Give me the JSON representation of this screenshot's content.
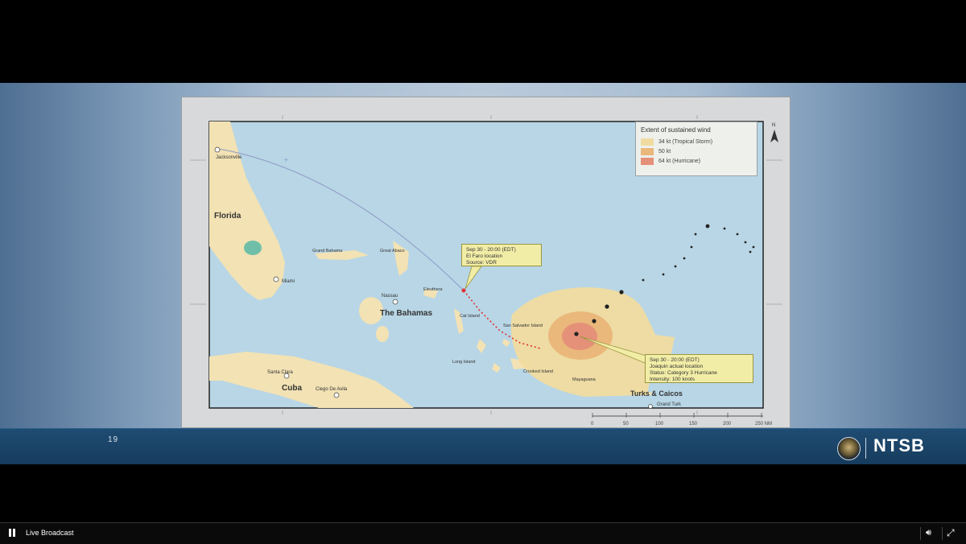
{
  "slide": {
    "number": "19",
    "brand": "NTSB",
    "map": {
      "legend": {
        "title": "Extent of sustained wind",
        "items": [
          {
            "label": "34 kt (Tropical Storm)",
            "color": "#f0dca0"
          },
          {
            "label": "50 kt",
            "color": "#eab87a"
          },
          {
            "label": "64 kt (Hurricane)",
            "color": "#e59078"
          }
        ]
      },
      "north": "N",
      "labels": {
        "jacksonville": "Jacksonville",
        "florida": "Florida",
        "miami": "Miami",
        "grand_bahama": "Grand Bahama",
        "great_abaco": "Great Abaco",
        "nassau": "Nassau",
        "eleuthera": "Eleuthera",
        "the_bahamas": "The Bahamas",
        "cat_island": "Cat Island",
        "san_salvador": "San Salvador Island",
        "long_island": "Long Island",
        "crooked_island": "Crooked Island",
        "mayaguana": "Mayaguana",
        "santa_clara": "Santa Clara",
        "cuba": "Cuba",
        "ciego_de_avila": "Ciego De Avila",
        "turks_caicos": "Turks & Caicos",
        "grand_turk": "Grand Turk"
      },
      "callout_elfaro": [
        "Sep 30 - 20:00 (EDT)",
        "El Faro location",
        "Source: VDR"
      ],
      "callout_joaquin": [
        "Sep 30 - 20:00 (EDT)",
        "Joaquin actual location",
        "Status: Category 3 Hurricane",
        "Intensity: 100 knots"
      ],
      "scale": {
        "ticks": [
          "0",
          "50",
          "100",
          "150",
          "200",
          "250 NM"
        ]
      }
    }
  },
  "player": {
    "status_label": "Live Broadcast"
  },
  "colors": {
    "ocean": "#b8d6e6",
    "land": "#f2e2b4",
    "track": "#8e98c4",
    "elfaro_track": "#e03030"
  }
}
